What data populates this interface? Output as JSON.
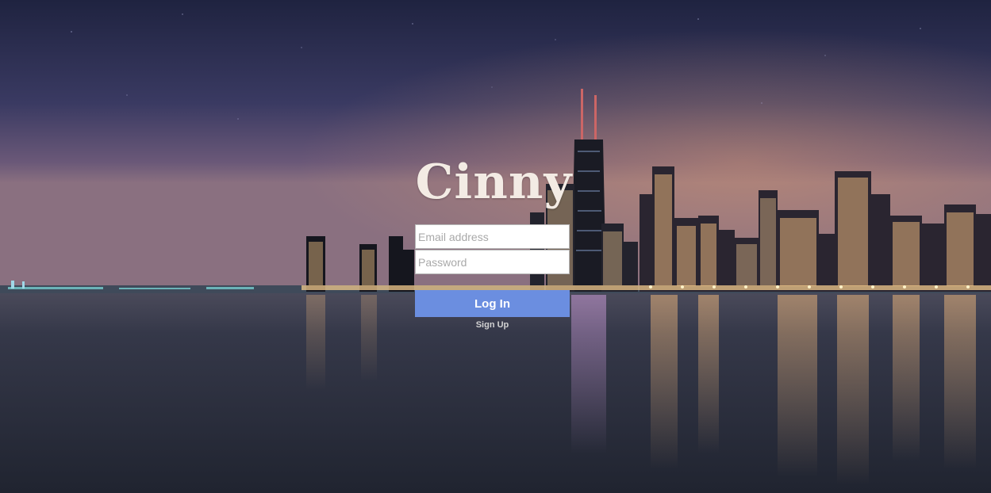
{
  "app": {
    "logo_text": "Cinny"
  },
  "login_form": {
    "email_placeholder": "Email address",
    "email_value": "",
    "password_placeholder": "Password",
    "password_value": "",
    "login_button_label": "Log In",
    "signup_link_label": "Sign Up"
  },
  "colors": {
    "button_bg": "#6b8ee0",
    "logo_color": "#f3ebe4",
    "signup_color": "#d2d2d2",
    "sky_top": "#232745",
    "sky_horizon": "#6b5a7a",
    "water": "#2c3040"
  },
  "background": {
    "description_icon": "city-skyline-night-image"
  }
}
